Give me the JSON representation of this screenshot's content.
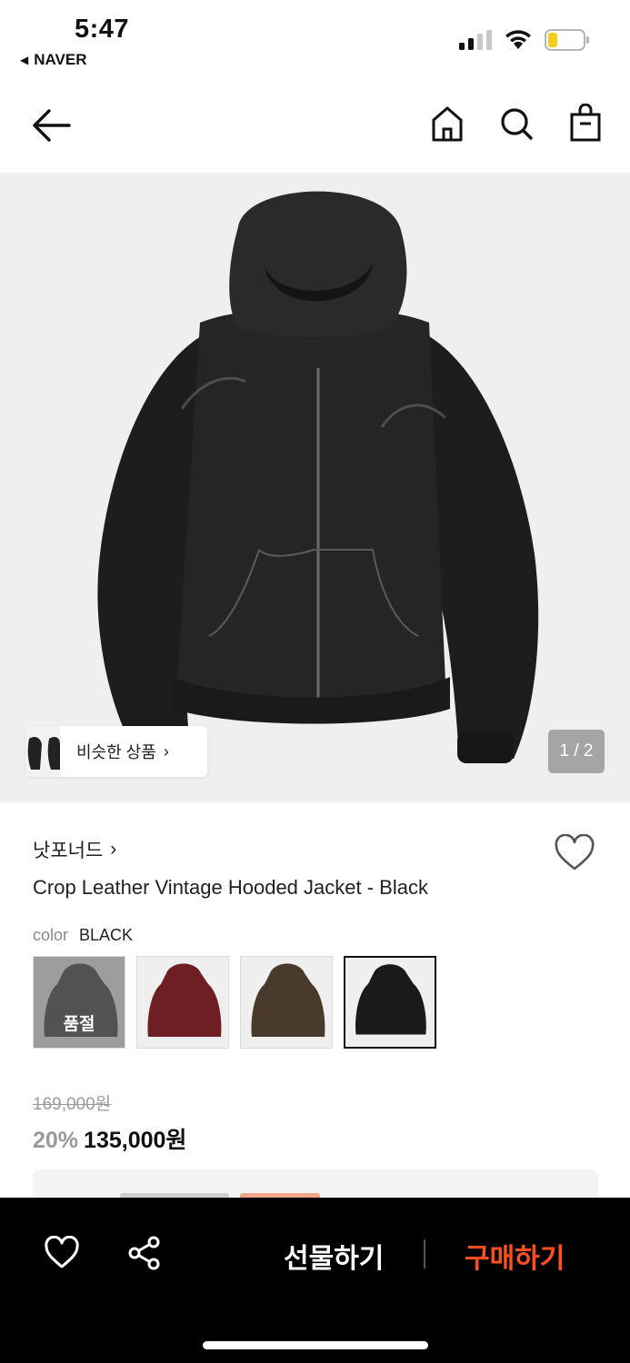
{
  "status_bar": {
    "time": "5:47",
    "back_app": "NAVER",
    "icons": [
      "cellular-signal-icon",
      "wifi-icon",
      "battery-icon"
    ]
  },
  "nav": {
    "icons": [
      "back-arrow-icon",
      "home-icon",
      "search-icon",
      "shopping-bag-icon"
    ]
  },
  "gallery": {
    "similar_label": "비슷한 상품",
    "page_indicator": "1 / 2"
  },
  "product": {
    "brand": "낫포너드",
    "title": "Crop Leather Vintage Hooded Jacket - Black",
    "color_label": "color",
    "color_value": "BLACK",
    "swatches": [
      {
        "color": "#4a4a4a",
        "status": "품절"
      },
      {
        "color": "#6e1f24",
        "status": ""
      },
      {
        "color": "#4a3a2c",
        "status": ""
      },
      {
        "color": "#1a1a1a",
        "status": ""
      }
    ],
    "original_price": "169,000원",
    "discount": "20%",
    "sale_price": "135,000원"
  },
  "bottom_bar": {
    "gift_label": "선물하기",
    "buy_label": "구매하기",
    "buy_color": "#ff4f1f",
    "icons": [
      "heart-icon",
      "share-icon"
    ]
  }
}
